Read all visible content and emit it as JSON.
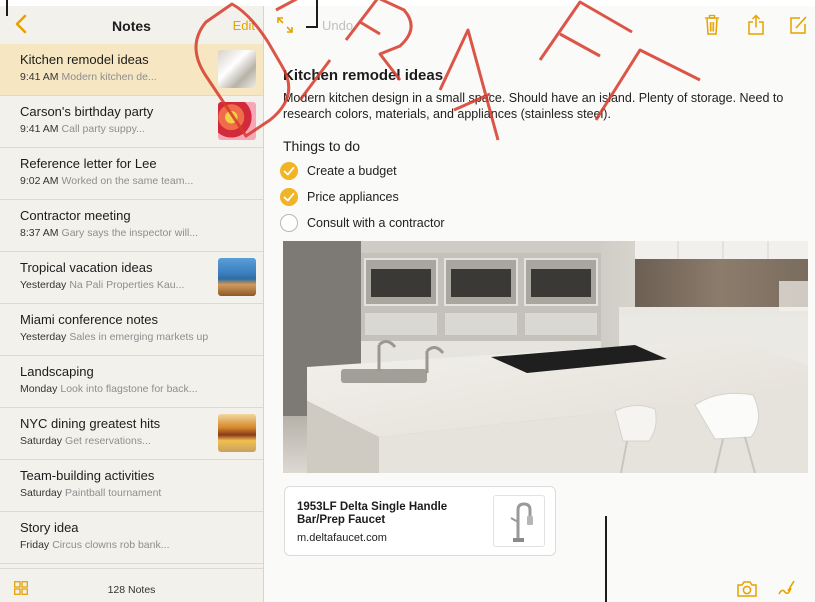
{
  "sidebar": {
    "title": "Notes",
    "edit_label": "Edit",
    "notes_count": "128 Notes",
    "notes": [
      {
        "title": "Kitchen remodel ideas",
        "time": "9:41 AM",
        "preview": "Modern kitchen de...",
        "thumbnail": "kitchen",
        "selected": true
      },
      {
        "title": "Carson's birthday party",
        "time": "9:41 AM",
        "preview": "Call party suppy...",
        "thumbnail": "party",
        "selected": false
      },
      {
        "title": "Reference letter for Lee",
        "time": "9:02 AM",
        "preview": "Worked on the same team...",
        "thumbnail": "",
        "selected": false
      },
      {
        "title": "Contractor meeting",
        "time": "8:37 AM",
        "preview": "Gary says the inspector will...",
        "thumbnail": "",
        "selected": false
      },
      {
        "title": "Tropical vacation ideas",
        "time": "Yesterday",
        "preview": "Na Pali Properties Kau...",
        "thumbnail": "beach",
        "selected": false
      },
      {
        "title": "Miami conference notes",
        "time": "Yesterday",
        "preview": "Sales in emerging markets up",
        "thumbnail": "",
        "selected": false
      },
      {
        "title": "Landscaping",
        "time": "Monday",
        "preview": "Look into flagstone for back...",
        "thumbnail": "",
        "selected": false
      },
      {
        "title": "NYC dining greatest hits",
        "time": "Saturday",
        "preview": "Get reservations...",
        "thumbnail": "food",
        "selected": false
      },
      {
        "title": "Team-building activities",
        "time": "Saturday",
        "preview": "Paintball tournament",
        "thumbnail": "",
        "selected": false
      },
      {
        "title": "Story idea",
        "time": "Friday",
        "preview": "Circus clowns rob bank...",
        "thumbnail": "",
        "selected": false
      }
    ]
  },
  "toolbar": {
    "undo_label": "Undo"
  },
  "note": {
    "title": "Kitchen remodel ideas",
    "body": "Modern kitchen design in a small space. Should have an island. Plenty of storage. Need to research colors, materials, and appliances (stainless steel).",
    "checklist_heading": "Things to do",
    "checklist": [
      {
        "label": "Create a budget",
        "done": true
      },
      {
        "label": "Price appliances",
        "done": true
      },
      {
        "label": "Consult with a contractor",
        "done": false
      }
    ],
    "link": {
      "title": "1953LF Delta Single Handle Bar/Prep Faucet",
      "url": "m.deltafaucet.com"
    }
  },
  "colors": {
    "accent": "#e6a200",
    "check_done": "#f2b325",
    "selected_row": "#f6e7c2",
    "watermark": "#d63a2a"
  },
  "icons": [
    "back-chevron-icon",
    "grid-view-icon",
    "expand-icon",
    "trash-icon",
    "share-icon",
    "compose-icon",
    "camera-icon",
    "sketch-icon"
  ]
}
